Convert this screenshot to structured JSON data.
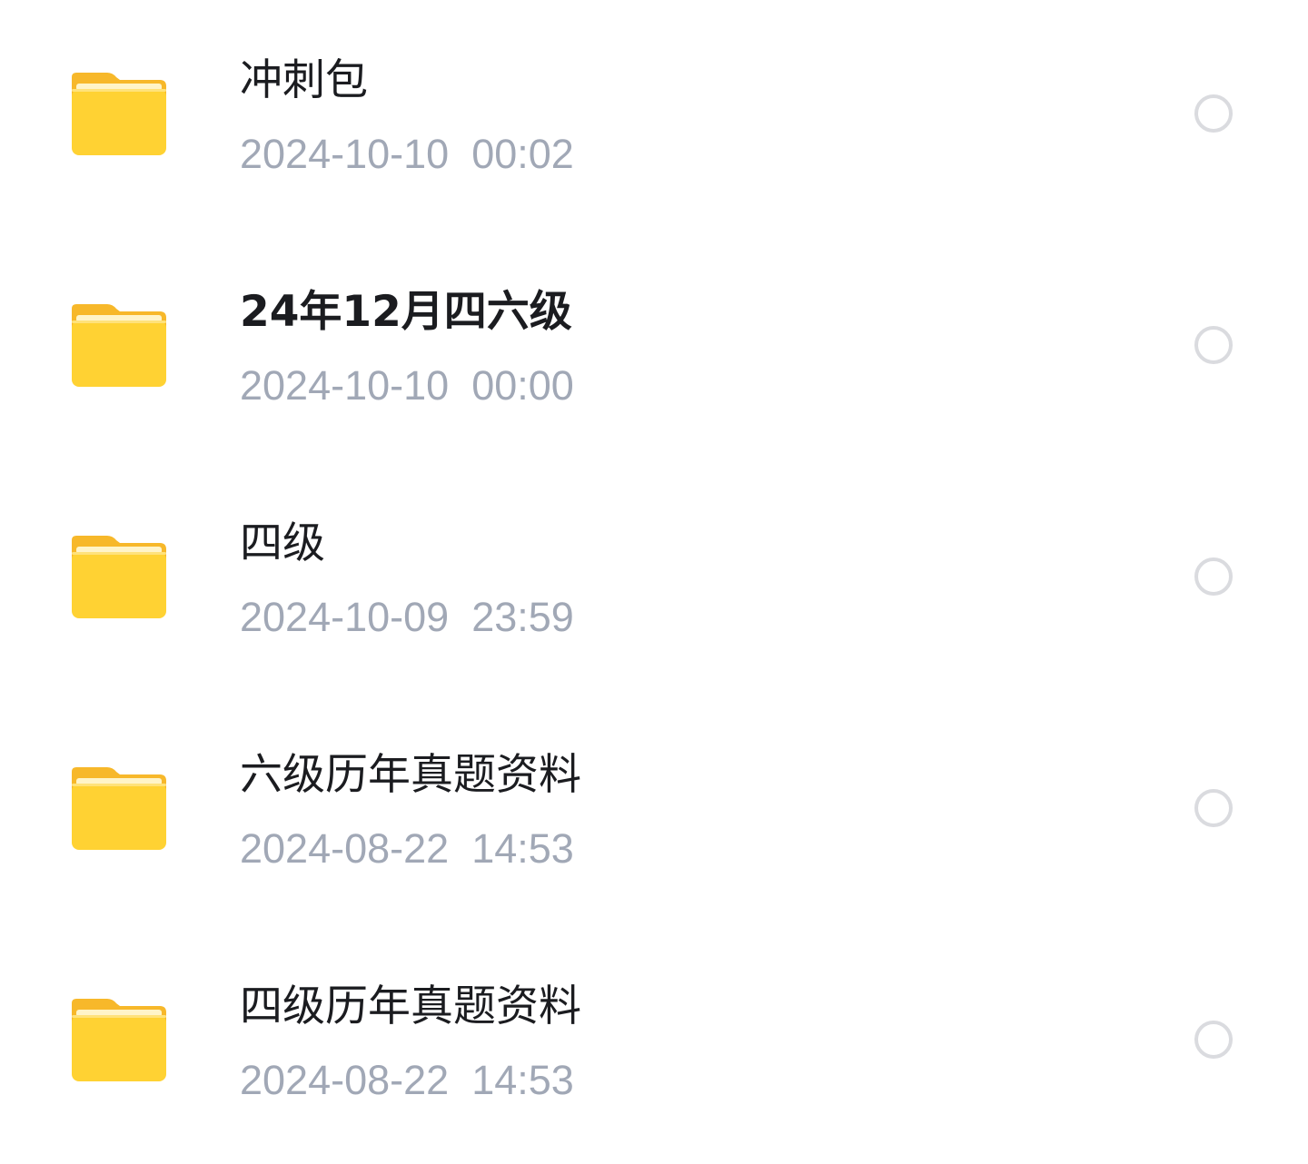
{
  "files": [
    {
      "name": "冲刺包",
      "date": "2024-10-10  00:02",
      "icon": "folder-icon"
    },
    {
      "name": "24年12月四六级",
      "date": "2024-10-10  00:00",
      "icon": "folder-icon"
    },
    {
      "name": "四级",
      "date": "2024-10-09  23:59",
      "icon": "folder-icon"
    },
    {
      "name": "六级历年真题资料",
      "date": "2024-08-22  14:53",
      "icon": "folder-icon"
    },
    {
      "name": "四级历年真题资料",
      "date": "2024-08-22  14:53",
      "icon": "folder-icon"
    }
  ],
  "colors": {
    "folder_yellow": "#ffd233",
    "name_text": "#1b1c20",
    "date_text": "#a1a8b6",
    "radio_border": "#dadbdf"
  }
}
